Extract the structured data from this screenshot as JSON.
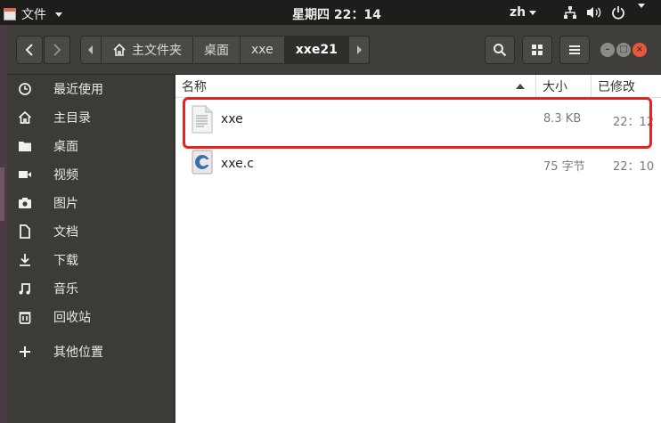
{
  "topbar": {
    "app_menu": "文件",
    "clock": "星期四 22：14",
    "lang": "zh"
  },
  "header": {
    "breadcrumbs": [
      {
        "label": "主文件夹"
      },
      {
        "label": "桌面"
      },
      {
        "label": "xxe"
      },
      {
        "label": "xxe21"
      }
    ]
  },
  "sidebar": {
    "items": [
      {
        "label": "最近使用",
        "icon": "clock-icon"
      },
      {
        "label": "主目录",
        "icon": "home-icon"
      },
      {
        "label": "桌面",
        "icon": "folder-icon"
      },
      {
        "label": "视频",
        "icon": "video-icon"
      },
      {
        "label": "图片",
        "icon": "camera-icon"
      },
      {
        "label": "文档",
        "icon": "document-icon"
      },
      {
        "label": "下载",
        "icon": "download-icon"
      },
      {
        "label": "音乐",
        "icon": "music-icon"
      },
      {
        "label": "回收站",
        "icon": "trash-icon"
      },
      {
        "label": "其他位置",
        "icon": "plus-icon"
      }
    ]
  },
  "list": {
    "columns": {
      "name": "名称",
      "size": "大小",
      "modified": "已修改"
    },
    "files": [
      {
        "name": "xxe",
        "size": "8.3 KB",
        "modified": "22：12",
        "icon": "text-file-icon"
      },
      {
        "name": "xxe.c",
        "size": "75 字节",
        "modified": "22：10",
        "icon": "c-source-file-icon"
      }
    ]
  },
  "colors": {
    "highlight": "#e52421",
    "close_button": "#e8583b"
  }
}
